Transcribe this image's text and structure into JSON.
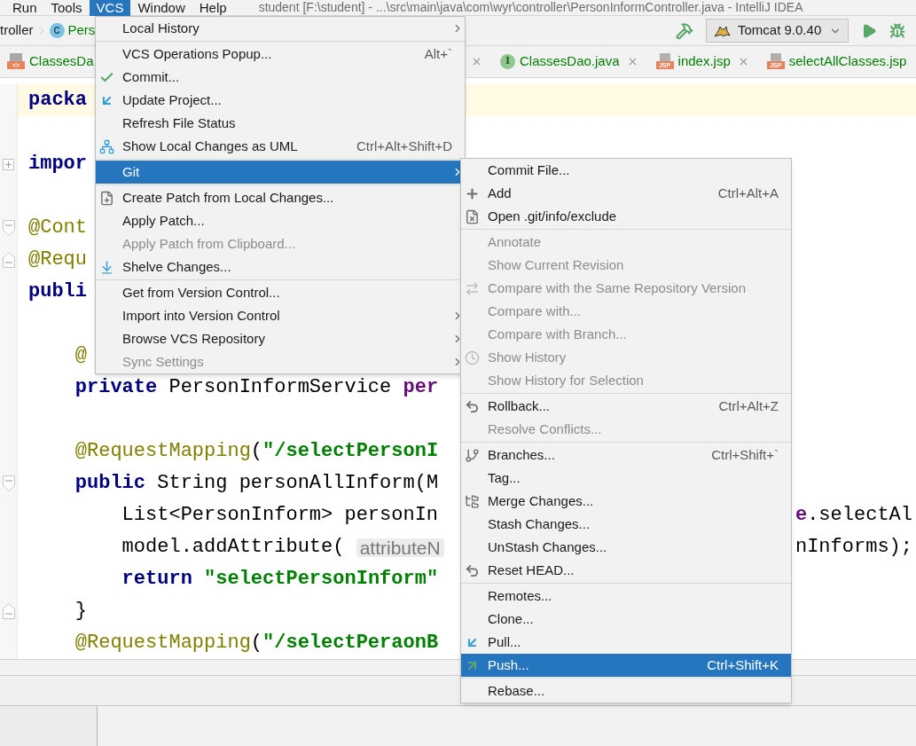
{
  "menu_bar": {
    "items": [
      {
        "label": "Run",
        "selected": false
      },
      {
        "label": "Tools",
        "selected": false
      },
      {
        "label": "VCS",
        "selected": true
      },
      {
        "label": "Window",
        "selected": false
      },
      {
        "label": "Help",
        "selected": false
      }
    ],
    "title": "student [F:\\student] - ...\\src\\main\\java\\com\\wyr\\controller\\PersonInformController.java - IntelliJ IDEA"
  },
  "navigation_bar": {
    "breadcrumbs": [
      {
        "label": "troller"
      },
      {
        "label": "Pers",
        "icon_text": "C"
      }
    ],
    "run_configuration": "Tomcat 9.0.40"
  },
  "editor_tabs": [
    {
      "label": "ClassesDa",
      "icon_text": "<>",
      "kind": "html"
    },
    {
      "label": "ClassesDao.java",
      "icon_text": "I",
      "kind": "interface"
    },
    {
      "label": "index.jsp",
      "icon_text": "JSP",
      "kind": "jsp"
    },
    {
      "label": "selectAllClasses.jsp",
      "icon_text": "JSP",
      "kind": "jsp"
    }
  ],
  "code_lines": [
    {
      "kind": "code",
      "current": true,
      "segments": [
        {
          "text": "packa",
          "kind": "keyword"
        }
      ]
    },
    {
      "kind": "blank"
    },
    {
      "kind": "folded",
      "segments": [
        {
          "text": "impor",
          "kind": "keyword"
        }
      ]
    },
    {
      "kind": "blank"
    },
    {
      "kind": "fold_start",
      "segments": [
        {
          "text": "@Cont",
          "kind": "annotation"
        }
      ]
    },
    {
      "kind": "fold_end",
      "segments": [
        {
          "text": "@Requ",
          "kind": "annotation"
        }
      ]
    },
    {
      "kind": "code",
      "segments": [
        {
          "text": "publi",
          "kind": "keyword"
        }
      ]
    },
    {
      "kind": "blank"
    },
    {
      "kind": "code",
      "segments": [
        {
          "text": "    @",
          "kind": "annotation"
        }
      ]
    },
    {
      "kind": "code",
      "segments": [
        {
          "text": "    private",
          "kind": "keyword"
        },
        {
          "text": " PersonInformService ",
          "kind": "plain"
        },
        {
          "text": "per",
          "kind": "field"
        }
      ]
    },
    {
      "kind": "blank"
    },
    {
      "kind": "code",
      "segments": [
        {
          "text": "    @RequestMapping",
          "kind": "annotation"
        },
        {
          "text": "(",
          "kind": "plain"
        },
        {
          "text": "\"/selectPersonI",
          "kind": "string"
        }
      ]
    },
    {
      "kind": "fold_start",
      "segments": [
        {
          "text": "    public",
          "kind": "keyword"
        },
        {
          "text": " String personAllInform(M",
          "kind": "plain"
        }
      ]
    },
    {
      "kind": "code",
      "segments": [
        {
          "text": "        List<PersonInform> personIn",
          "kind": "plain"
        }
      ],
      "right": [
        {
          "text": "e",
          "kind": "field"
        },
        {
          "text": ".selectAl",
          "kind": "plain"
        }
      ]
    },
    {
      "kind": "code",
      "segments": [
        {
          "text": "        model.addAttribute( ",
          "kind": "plain"
        },
        {
          "text": "attributeN",
          "kind": "hint"
        }
      ],
      "right": [
        {
          "text": "nInforms);",
          "kind": "plain"
        }
      ]
    },
    {
      "kind": "code",
      "segments": [
        {
          "text": "        return",
          "kind": "keyword"
        },
        {
          "text": " \"selectPersonInform\"",
          "kind": "string"
        }
      ]
    },
    {
      "kind": "fold_end",
      "segments": [
        {
          "text": "    }",
          "kind": "plain"
        }
      ]
    },
    {
      "kind": "code",
      "segments": [
        {
          "text": "    @RequestMapping",
          "kind": "annotation"
        },
        {
          "text": "(",
          "kind": "plain"
        },
        {
          "text": "\"/selectPeraonB",
          "kind": "string"
        }
      ]
    }
  ],
  "vcs_menu": {
    "groups": [
      [
        {
          "label": "Local History",
          "submenu": true,
          "disabled": false,
          "selected": false
        }
      ],
      [
        {
          "label": "VCS Operations Popup...",
          "shortcut": "Alt+`",
          "disabled": false,
          "selected": false
        },
        {
          "label": "Commit...",
          "kind": "commit",
          "disabled": false,
          "selected": false
        },
        {
          "label": "Update Project...",
          "kind": "update",
          "disabled": false,
          "selected": false
        },
        {
          "label": "Refresh File Status",
          "disabled": false,
          "selected": false
        },
        {
          "label": "Show Local Changes as UML",
          "kind": "uml",
          "shortcut": "Ctrl+Alt+Shift+D",
          "disabled": false,
          "selected": false
        }
      ],
      [
        {
          "label": "Git",
          "submenu": true,
          "disabled": false,
          "selected": true
        }
      ],
      [
        {
          "label": "Create Patch from Local Changes...",
          "kind": "patch",
          "disabled": false,
          "selected": false
        },
        {
          "label": "Apply Patch...",
          "disabled": false,
          "selected": false
        },
        {
          "label": "Apply Patch from Clipboard...",
          "disabled": true,
          "selected": false
        },
        {
          "label": "Shelve Changes...",
          "kind": "shelve",
          "disabled": false,
          "selected": false
        }
      ],
      [
        {
          "label": "Get from Version Control...",
          "disabled": false,
          "selected": false
        },
        {
          "label": "Import into Version Control",
          "submenu": true,
          "disabled": false,
          "selected": false
        },
        {
          "label": "Browse VCS Repository",
          "submenu": true,
          "disabled": false,
          "selected": false
        },
        {
          "label": "Sync Settings",
          "submenu": true,
          "disabled": true,
          "selected": false
        }
      ]
    ]
  },
  "git_submenu": {
    "groups": [
      [
        {
          "label": "Commit File...",
          "disabled": false,
          "selected": false
        },
        {
          "label": "Add",
          "kind": "add",
          "shortcut": "Ctrl+Alt+A",
          "disabled": false,
          "selected": false
        },
        {
          "label": "Open .git/info/exclude",
          "kind": "exclude",
          "disabled": false,
          "selected": false
        }
      ],
      [
        {
          "label": "Annotate",
          "disabled": true,
          "selected": false
        },
        {
          "label": "Show Current Revision",
          "disabled": true,
          "selected": false
        },
        {
          "label": "Compare with the Same Repository Version",
          "kind": "compare",
          "disabled": true,
          "selected": false
        },
        {
          "label": "Compare with...",
          "disabled": true,
          "selected": false
        },
        {
          "label": "Compare with Branch...",
          "disabled": true,
          "selected": false
        },
        {
          "label": "Show History",
          "kind": "history",
          "disabled": true,
          "selected": false
        },
        {
          "label": "Show History for Selection",
          "disabled": true,
          "selected": false
        }
      ],
      [
        {
          "label": "Rollback...",
          "kind": "rollback",
          "shortcut": "Ctrl+Alt+Z",
          "disabled": false,
          "selected": false
        },
        {
          "label": "Resolve Conflicts...",
          "disabled": true,
          "selected": false
        }
      ],
      [
        {
          "label": "Branches...",
          "kind": "branch",
          "shortcut": "Ctrl+Shift+`",
          "disabled": false,
          "selected": false
        },
        {
          "label": "Tag...",
          "disabled": false,
          "selected": false
        },
        {
          "label": "Merge Changes...",
          "kind": "merge",
          "disabled": false,
          "selected": false
        },
        {
          "label": "Stash Changes...",
          "disabled": false,
          "selected": false
        },
        {
          "label": "UnStash Changes...",
          "disabled": false,
          "selected": false
        },
        {
          "label": "Reset HEAD...",
          "kind": "rollback",
          "disabled": false,
          "selected": false
        }
      ],
      [
        {
          "label": "Remotes...",
          "disabled": false,
          "selected": false
        },
        {
          "label": "Clone...",
          "disabled": false,
          "selected": false
        },
        {
          "label": "Pull...",
          "kind": "update",
          "disabled": false,
          "selected": false
        },
        {
          "label": "Push...",
          "kind": "push",
          "shortcut": "Ctrl+Shift+K",
          "disabled": false,
          "selected": true
        }
      ],
      [
        {
          "label": "Rebase...",
          "disabled": false,
          "selected": false
        }
      ]
    ]
  }
}
